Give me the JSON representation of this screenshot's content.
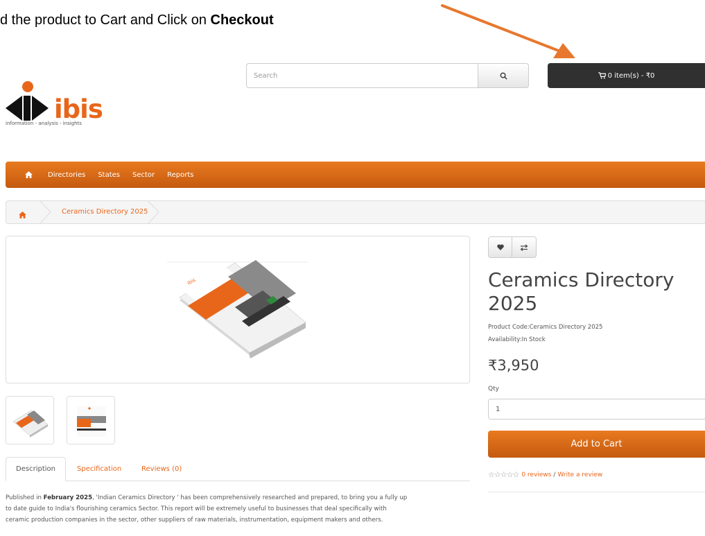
{
  "instruction": {
    "prefix": "d the product to Cart and Click on ",
    "bold": "Checkout"
  },
  "search": {
    "placeholder": "Search"
  },
  "cart": {
    "label": "0 item(s) - ₹0"
  },
  "logo": {
    "word": "ibis",
    "tagline": "information - analysis - insights"
  },
  "nav": {
    "items": [
      "Directories",
      "States",
      "Sector",
      "Reports"
    ]
  },
  "breadcrumb": {
    "current": "Ceramics Directory 2025"
  },
  "tabs": {
    "description": "Description",
    "specification": "Specification",
    "reviews": "Reviews (0)"
  },
  "description": {
    "lead": "Published in ",
    "bold": "February 2025",
    "line1_rest": ", 'Indian Ceramics Directory ' has been comprehensively researched and prepared, to bring you a fully up",
    "line2": "to date guide to India's flourishing ceramics Sector. This report will be extremely useful to businesses that deal specifically with",
    "line3": "ceramic production companies in the sector, other suppliers of raw materials, instrumentation, equipment makers and others."
  },
  "product": {
    "title": "Ceramics Directory 2025",
    "code_label": "Product Code:",
    "code": "Ceramics Directory 2025",
    "availability_label": "Availability:",
    "availability": "In Stock",
    "price": "₹3,950",
    "qty_label": "Qty",
    "qty_value": "1",
    "add_to_cart": "Add to Cart",
    "stars": "☆☆☆☆☆",
    "reviews_link": "0 reviews",
    "review_sep": "/",
    "write_review": "Write a review"
  },
  "colors": {
    "accent": "#e8661a",
    "cart_bg": "#303030",
    "arrow": "#e8772e"
  },
  "icons": [
    "search-icon",
    "cart-icon",
    "home-icon",
    "heart-icon",
    "compare-icon",
    "star-icon"
  ]
}
